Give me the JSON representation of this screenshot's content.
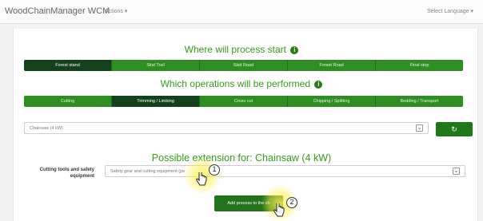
{
  "navbar": {
    "brand": "WoodChainManager WCM",
    "actions_label": "Actions ▾",
    "language_label": "Select Language ▾"
  },
  "start_section": {
    "title": "Where will process start",
    "options": [
      "Forest stand",
      "Skid Trail",
      "Skid Road",
      "Forest Road",
      "Final stop"
    ],
    "active_index": 0
  },
  "operations_section": {
    "title": "Which operations will be performed",
    "options": [
      "Cutting",
      "Trimming / Limbing",
      "Cross cut",
      "Chipping / Splitting",
      "Bedding / Transport"
    ],
    "active_index": 1
  },
  "machine_select": {
    "value": "Chainsaw (4 kW)",
    "refresh_icon": "↻"
  },
  "extension_section": {
    "title": "Possible extension for: Chainsaw (4 kW)",
    "field_label": "Cutting tools and safety equipment",
    "field_value": "Safety gear and cutting equipment (pe"
  },
  "add_button_label": "Add process to the ch",
  "markers": [
    "1",
    "2"
  ],
  "colors": {
    "accent_green": "#2f8e22",
    "active_green": "#13421a",
    "title_green": "#3a9a1f",
    "highlight_yellow": "#fff050"
  }
}
